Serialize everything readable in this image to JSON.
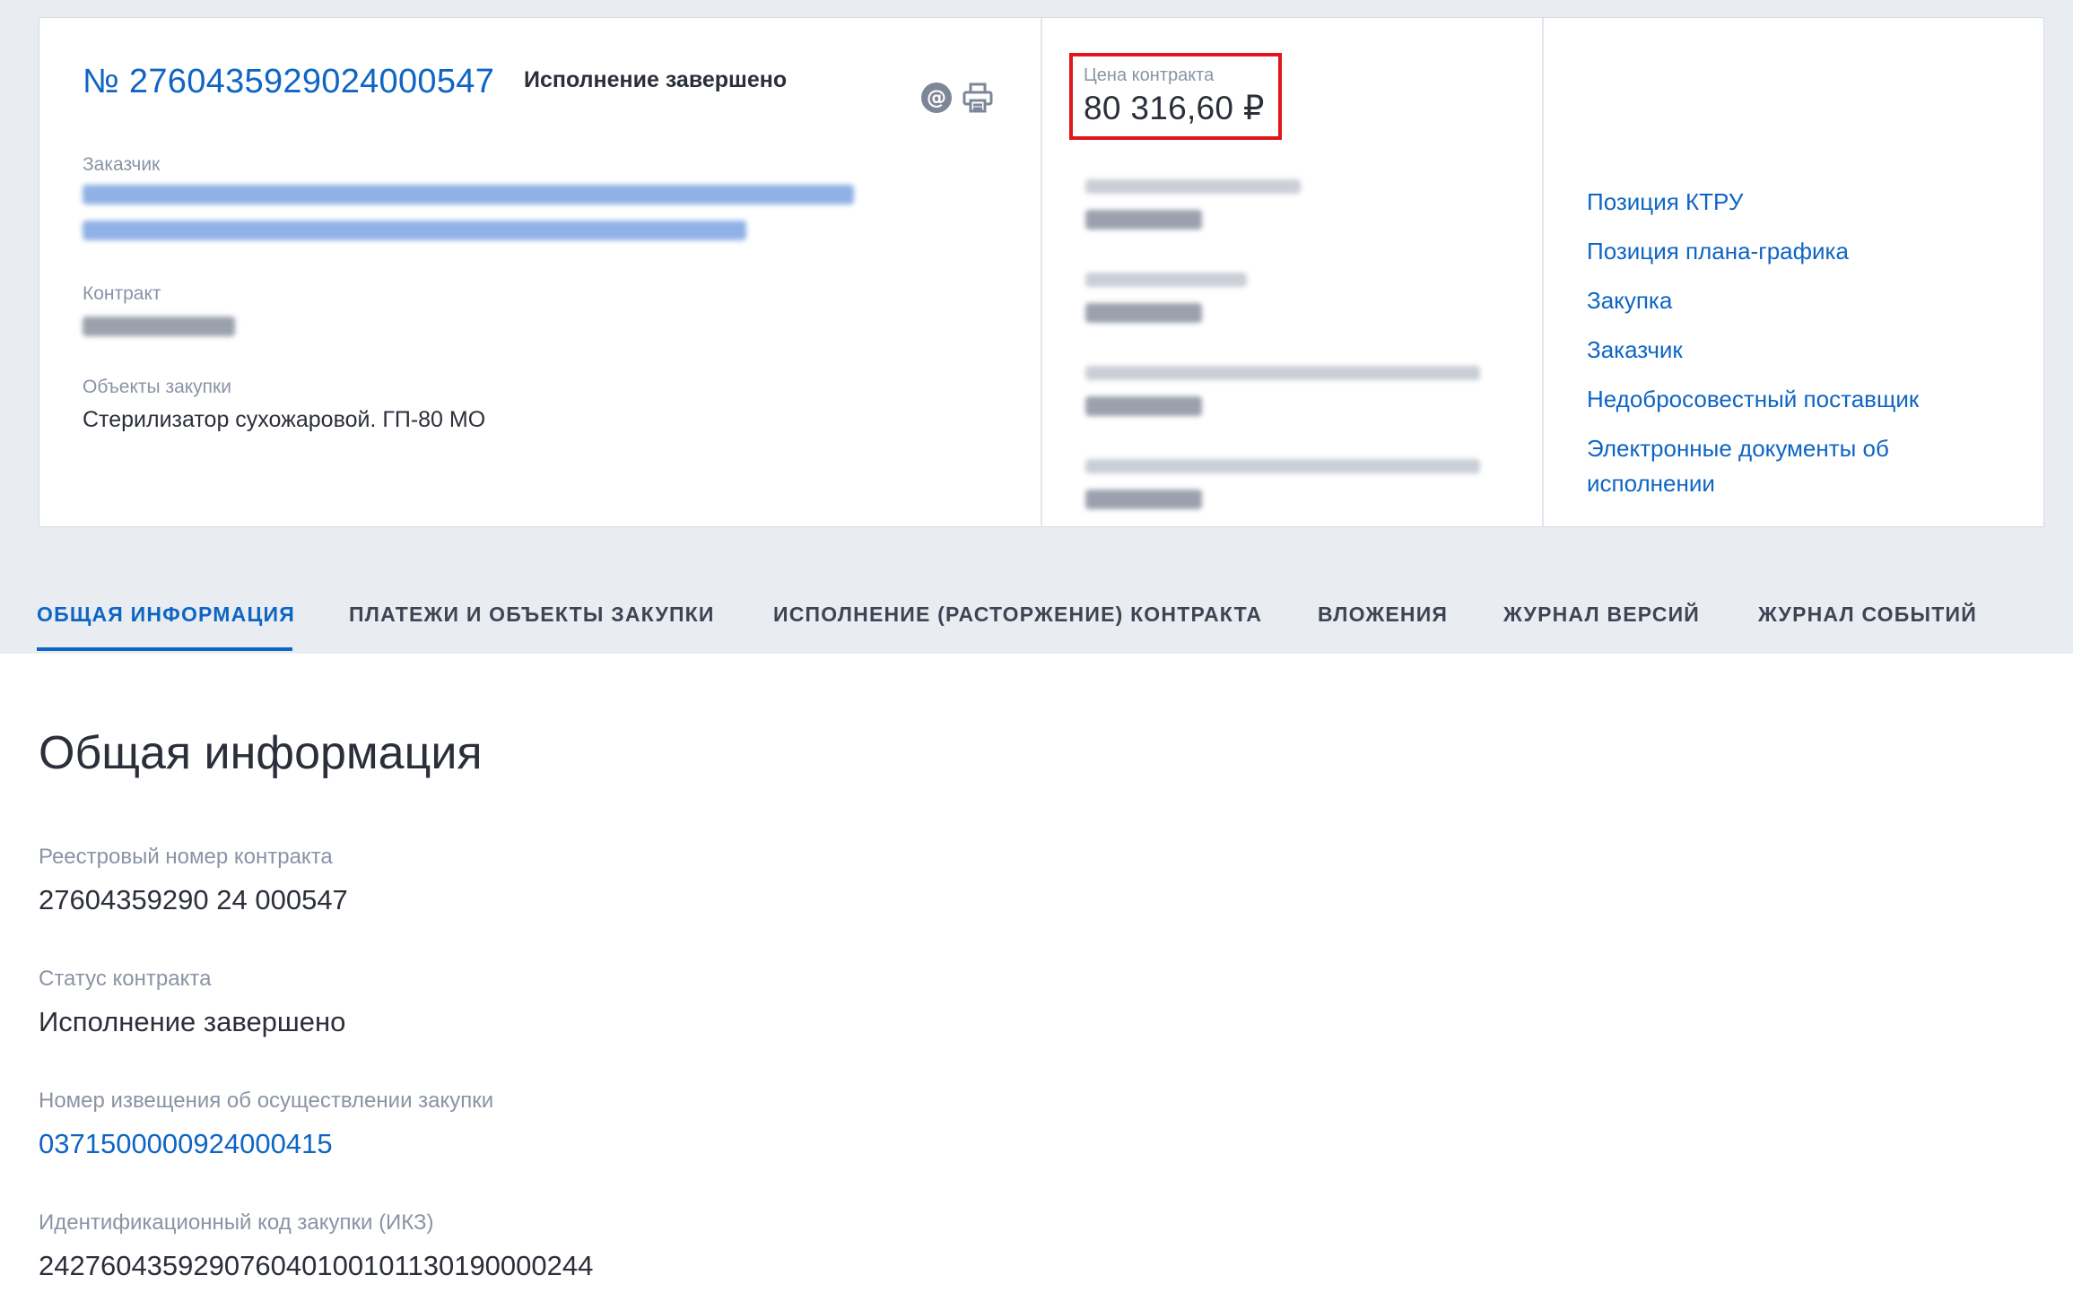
{
  "header": {
    "contract_number": "№ 2760435929024000547",
    "status": "Исполнение завершено",
    "email_icon": "at-sign-icon",
    "print_icon": "printer-icon",
    "customer_label": "Заказчик",
    "contract_label": "Контракт",
    "objects_label": "Объекты закупки",
    "objects_value": "Стерилизатор сухожаровой. ГП-80 МО"
  },
  "price": {
    "label": "Цена контракта",
    "value": "80 316,60 ₽"
  },
  "links": [
    "Позиция КТРУ",
    "Позиция плана-графика",
    "Закупка",
    "Заказчик",
    "Недобросовестный поставщик",
    "Электронные документы об",
    "исполнении"
  ],
  "tabs": [
    "ОБЩАЯ ИНФОРМАЦИЯ",
    "ПЛАТЕЖИ И ОБЪЕКТЫ ЗАКУПКИ",
    "ИСПОЛНЕНИЕ (РАСТОРЖЕНИЕ) КОНТРАКТА",
    "ВЛОЖЕНИЯ",
    "ЖУРНАЛ ВЕРСИЙ",
    "ЖУРНАЛ СОБЫТИЙ"
  ],
  "general": {
    "title": "Общая информация",
    "fields": [
      {
        "label": "Реестровый номер контракта",
        "value": "27604359290 24 000547"
      },
      {
        "label": "Статус контракта",
        "value": "Исполнение завершено"
      },
      {
        "label": "Номер извещения об осуществлении закупки",
        "value": "0371500000924000415"
      },
      {
        "label": "Идентификационный код закупки (ИКЗ)",
        "value": "242760435929076040100101130190000244"
      }
    ]
  },
  "colors": {
    "accent": "#0e65c4",
    "highlight_border": "#e0161b",
    "header_bg": "#e9ecf0"
  }
}
